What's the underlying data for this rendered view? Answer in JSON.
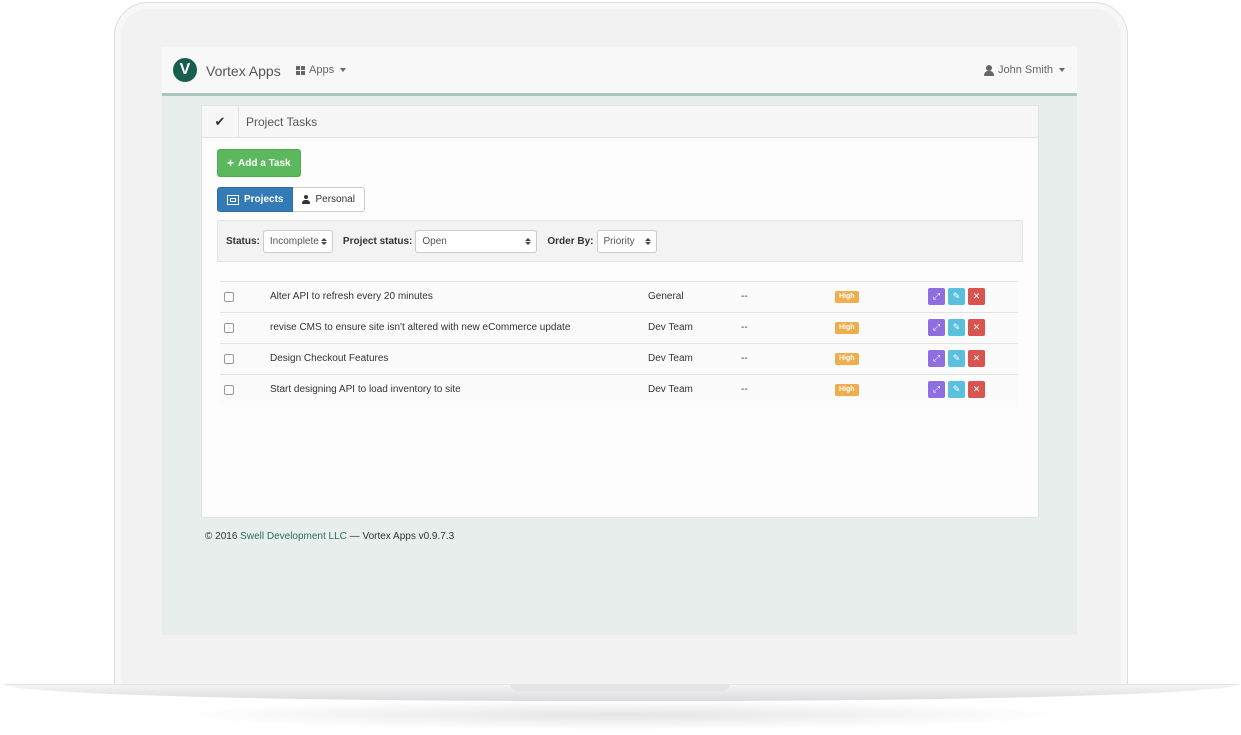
{
  "navbar": {
    "brand_letter": "V",
    "brand_name": "Vortex Apps",
    "apps_label": "Apps",
    "user_name": "John Smith"
  },
  "panel": {
    "title": "Project Tasks",
    "add_button": "Add a Task",
    "tabs": [
      {
        "label": "Projects",
        "active": true
      },
      {
        "label": "Personal",
        "active": false
      }
    ]
  },
  "filters": {
    "status_label": "Status:",
    "status_value": "Incomplete",
    "project_status_label": "Project status:",
    "project_status_value": "Open",
    "order_label": "Order By:",
    "order_value": "Priority"
  },
  "tasks": [
    {
      "name": "Alter API to refresh every 20 minutes",
      "team": "General",
      "due": "--",
      "priority": "High"
    },
    {
      "name": "revise CMS to ensure site isn't altered with new eCommerce update",
      "team": "Dev Team",
      "due": "--",
      "priority": "High"
    },
    {
      "name": "Design Checkout Features",
      "team": "Dev Team",
      "due": "--",
      "priority": "High"
    },
    {
      "name": "Start designing API to load inventory to site",
      "team": "Dev Team",
      "due": "--",
      "priority": "High"
    }
  ],
  "footer": {
    "prefix": "© 2016 ",
    "company": "Swell Development LLC",
    "suffix": " — Vortex Apps v0.9.7.3"
  },
  "colors": {
    "brand": "#175e4f",
    "primary": "#337ab7",
    "success": "#5cb85c",
    "warning": "#f0ad4e",
    "danger": "#d9534f",
    "info": "#5bc0de",
    "purple": "#8e6ee0"
  }
}
